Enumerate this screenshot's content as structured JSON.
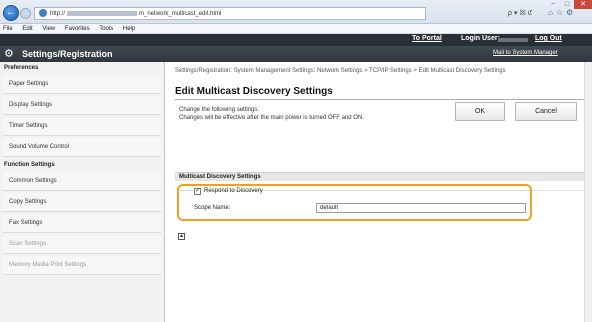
{
  "browser": {
    "address_prefix": "http://",
    "address_suffix": "m_network_multicast_edit.html",
    "address_tools": "ρ▾☒ℭ",
    "icons": "⌂☆⚙",
    "back_glyph": "←",
    "forward_glyph": "→",
    "window_controls": [
      "−",
      "□",
      "✕"
    ],
    "menu": [
      "File",
      "Edit",
      "View",
      "Favorites",
      "Tools",
      "Help"
    ]
  },
  "header": {
    "title": "Settings/Registration",
    "toportal_label": "To Portal",
    "login_user_label": "Login User:",
    "logout_label": "Log Out",
    "mail_label": "Mail to System Manager",
    "gear_glyph": "⚙"
  },
  "sidebar": {
    "preferences_heading": "Preferences",
    "preferences_items": [
      "Paper Settings",
      "Display Settings",
      "Timer Settings",
      "Sound Volume Control"
    ],
    "function_heading": "Function Settings",
    "function_items": [
      "Common Settings",
      "Copy Settings",
      "Fax Settings",
      "Scan Settings",
      "Memory Media Print Settings"
    ]
  },
  "main": {
    "breadcrumb": "Settings/Registration: System Management Settings: Network Settings > TCP/IP Settings > Edit Multicast Discovery Settings",
    "page_title": "Edit Multicast Discovery Settings",
    "note_line1": "Change the following settings.",
    "note_line2": "Changes will be effective after the main power is turned OFF and ON.",
    "ok_label": "OK",
    "cancel_label": "Cancel",
    "section_title": "Multicast Discovery Settings",
    "respond_label": "Respond to Discovery",
    "respond_checked": true,
    "check_glyph": "✓",
    "scope_label": "Scope Name:",
    "scope_value": "default",
    "top_glyph": "▲"
  },
  "colors": {
    "highlight": "#f0a020",
    "header_bg": "#2f363d"
  }
}
